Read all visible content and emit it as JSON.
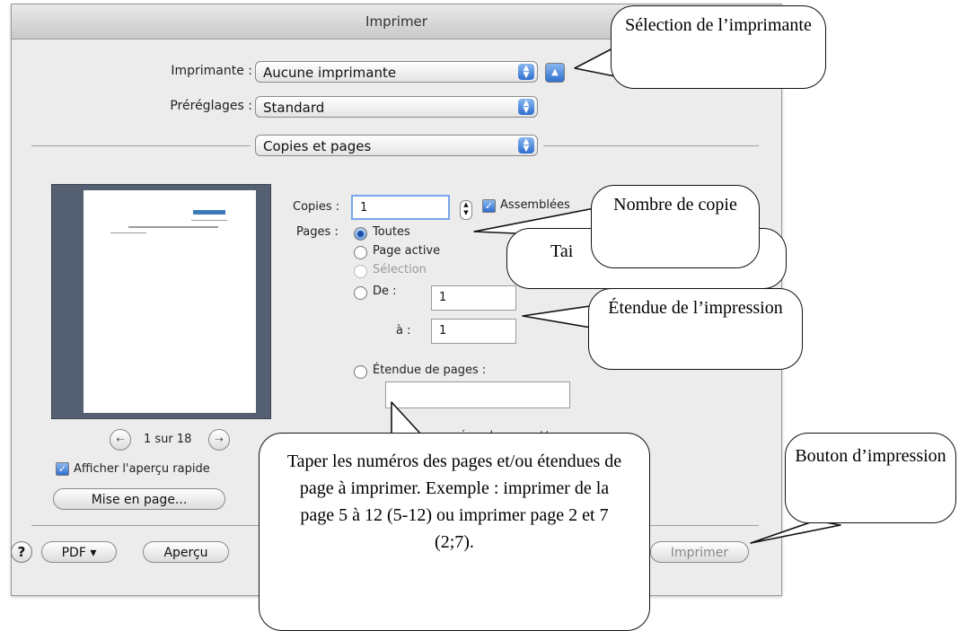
{
  "dialog": {
    "title": "Imprimer",
    "printer_label": "Imprimante :",
    "printer_value": "Aucune imprimante",
    "presets_label": "Préréglages :",
    "presets_value": "Standard",
    "section_value": "Copies et pages",
    "copies_label": "Copies :",
    "copies_value": "1",
    "collated_label": "Assemblées",
    "pages_label": "Pages :",
    "page_options": [
      "Toutes",
      "Page active",
      "Sélection",
      "De :"
    ],
    "from_value": "1",
    "to_label": "à :",
    "to_value": "1",
    "range_label": "Étendue de pages :",
    "range_hint_partial": "z les numéros de page et/ou",
    "page_nav": "1 sur 18",
    "quick_preview_label": "Afficher l'aperçu rapide",
    "page_setup_button": "Mise en page...",
    "help_button": "?",
    "pdf_button": "PDF ▾",
    "preview_button": "Aperçu",
    "print_button": "Imprimer",
    "partial_hidden_text": "Tai"
  },
  "callouts": {
    "printer_selection": "Sélection de l’imprimante",
    "copies_count": "Nombre de copie",
    "print_range": "Étendue de l’impression",
    "page_numbers": "Taper les numéros des pages et/ou étendues de page à imprimer. Exemple : imprimer de la page 5 à 12 (5-12) ou imprimer page 2 et 7 (2;7).",
    "print_button": "Bouton d’impression"
  },
  "icons": {
    "popup_arrows": "updown-arrows-icon",
    "eject": "triangle-up-icon",
    "stepper": "stepper-icon",
    "nav_prev": "arrow-left-icon",
    "nav_next": "arrow-right-icon",
    "checkbox": "checkmark-icon"
  },
  "colors": {
    "accent": "#2f6fd0",
    "preview_bg": "#566073"
  }
}
